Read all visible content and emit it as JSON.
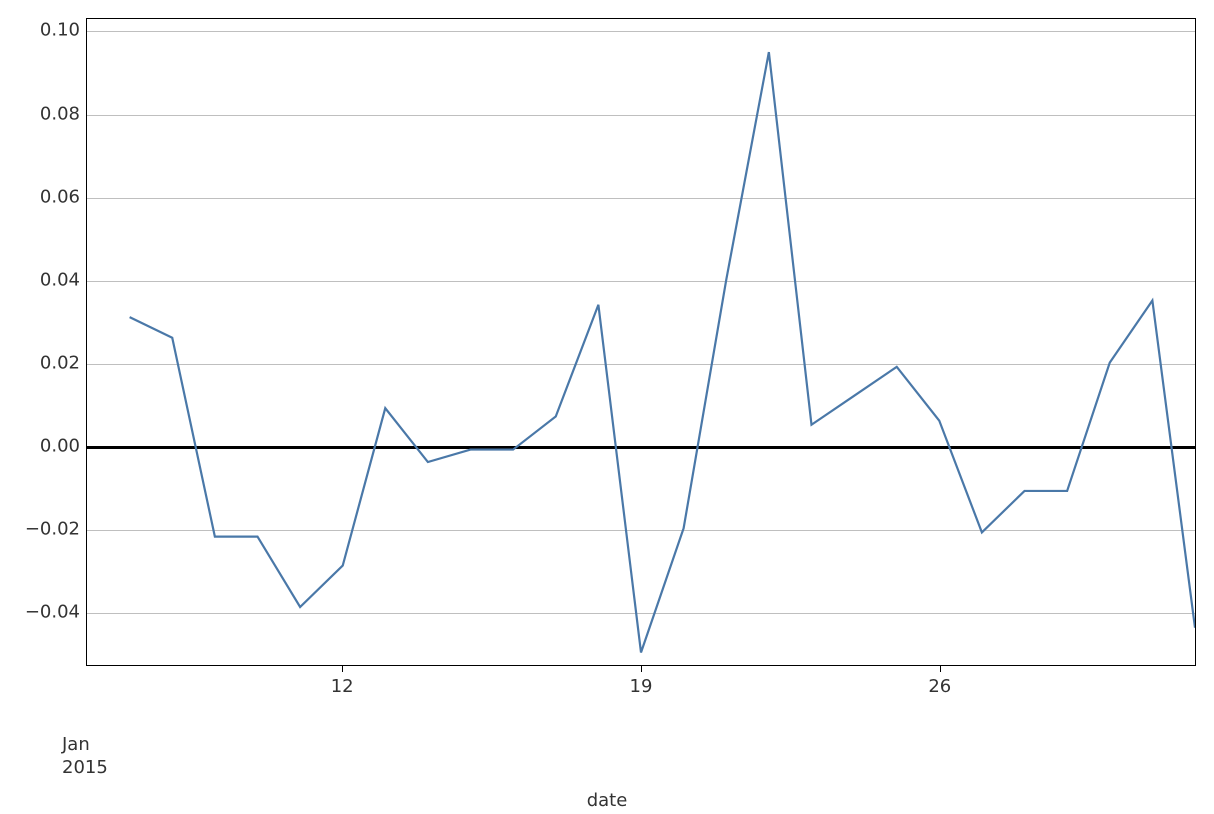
{
  "chart_data": {
    "type": "line",
    "title": "",
    "xlabel": "date",
    "ylabel": "",
    "xlim_dates": [
      "2015-01-06",
      "2015-02-01"
    ],
    "ylim": [
      -0.053,
      0.103
    ],
    "x_major_ticks": [
      "12",
      "19",
      "26"
    ],
    "x_month_label": "Jan\n2015",
    "y_ticks": [
      -0.04,
      -0.02,
      0.0,
      0.02,
      0.04,
      0.06,
      0.08,
      0.1
    ],
    "y_tick_labels": [
      "−0.04",
      "−0.02",
      "0.00",
      "0.02",
      "0.04",
      "0.06",
      "0.08",
      "0.10"
    ],
    "grid": true,
    "legend": false,
    "series": [
      {
        "name": "value",
        "color": "#4a78a8",
        "x_dates": [
          "2015-01-07",
          "2015-01-08",
          "2015-01-09",
          "2015-01-10",
          "2015-01-11",
          "2015-01-12",
          "2015-01-13",
          "2015-01-14",
          "2015-01-15",
          "2015-01-16",
          "2015-01-17",
          "2015-01-18",
          "2015-01-19",
          "2015-01-20",
          "2015-01-21",
          "2015-01-22",
          "2015-01-23",
          "2015-01-24",
          "2015-01-25",
          "2015-01-26",
          "2015-01-27",
          "2015-01-28",
          "2015-01-29",
          "2015-01-30",
          "2015-01-31",
          "2015-02-01"
        ],
        "y": [
          0.031,
          0.026,
          -0.022,
          -0.022,
          -0.039,
          -0.029,
          0.009,
          -0.004,
          -0.001,
          -0.001,
          0.007,
          0.034,
          -0.05,
          -0.02,
          0.04,
          0.095,
          0.005,
          0.012,
          0.019,
          0.006,
          -0.021,
          -0.011,
          -0.011,
          0.02,
          0.035,
          -0.044
        ]
      }
    ]
  },
  "axes": {
    "xlabel": "date",
    "month_line1": "Jan",
    "month_line2": "2015",
    "x_ticks": {
      "t12": "12",
      "t19": "19",
      "t26": "26"
    },
    "y_ticks": {
      "n004": "−0.04",
      "n002": "−0.02",
      "z000": "0.00",
      "p002": "0.02",
      "p004": "0.04",
      "p006": "0.06",
      "p008": "0.08",
      "p010": "0.10"
    }
  }
}
